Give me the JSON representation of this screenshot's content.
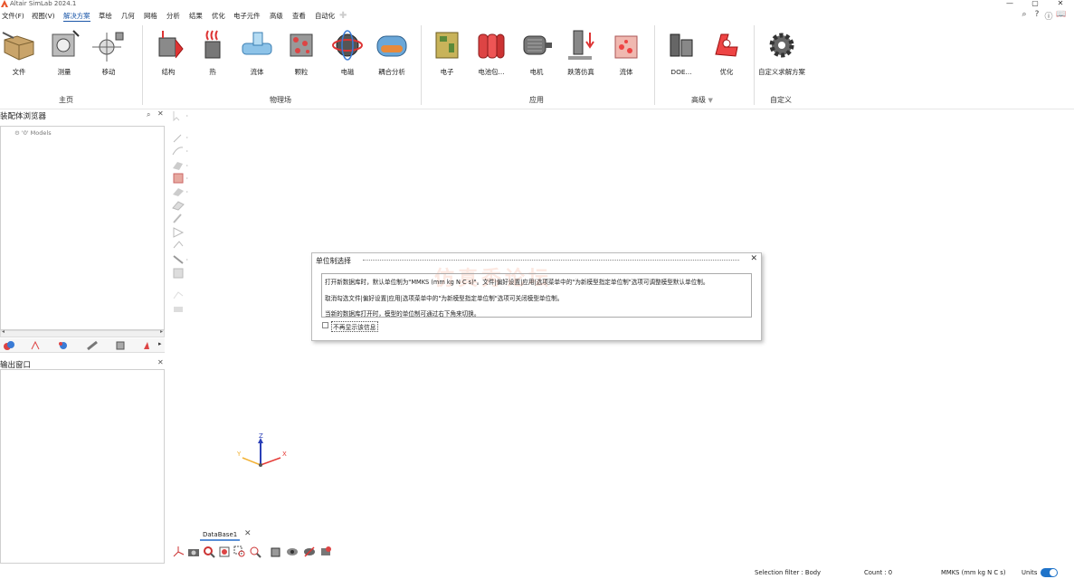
{
  "app": {
    "title": "Altair SimLab 2024.1"
  },
  "menu": {
    "items": [
      "文件(F)",
      "视图(V)",
      "解决方案",
      "草绘",
      "几何",
      "网格",
      "分析",
      "结果",
      "优化",
      "电子元件",
      "高级",
      "查看",
      "自动化"
    ],
    "active": "解决方案"
  },
  "ribbon": {
    "groups": [
      {
        "label": "主页",
        "buttons": [
          "文件",
          "测量",
          "移动"
        ]
      },
      {
        "label": "物理场",
        "buttons": [
          "结构",
          "热",
          "流体",
          "颗粒",
          "电磁",
          "耦合分析"
        ]
      },
      {
        "label": "应用",
        "buttons": [
          "电子",
          "电池包...",
          "电机",
          "跌落仿真",
          "流体"
        ]
      },
      {
        "label": "高级",
        "buttons": [
          "DOE...",
          "优化"
        ]
      },
      {
        "label": "自定义",
        "buttons": [
          "自定义求解方案"
        ]
      }
    ]
  },
  "assembly_browser": {
    "title": "装配体浏览器",
    "tree": [
      "'0' Models"
    ]
  },
  "output_window": {
    "title": "输出窗口"
  },
  "dialog": {
    "title": "单位制选择",
    "lines": [
      "打开新数据库时，默认单位制为\"MMKS (mm kg N C s)\"。文件|偏好设置|应用|选项菜单中的\"为新模型指定单位制\"选项可调整模型默认单位制。",
      "取消勾选文件|偏好设置|应用|选项菜单中的\"为新模型指定单位制\"选项可关闭模型单位制。",
      "当新的数据库打开时，模型的单位制可通过右下角来切换。"
    ],
    "checkbox_label": "不再显示该信息",
    "watermark": "仿真秀论坛"
  },
  "axis": {
    "x": "X",
    "y": "Y",
    "z": "Z"
  },
  "tabs": {
    "database": "DataBase1"
  },
  "status": {
    "selection_filter": "Selection filter : Body",
    "count": "Count : 0",
    "units": "MMKS (mm kg N C s)",
    "units_label": "Units"
  },
  "colors": {
    "accent": "#1f73c9",
    "menu_active": "#1a56a8"
  }
}
